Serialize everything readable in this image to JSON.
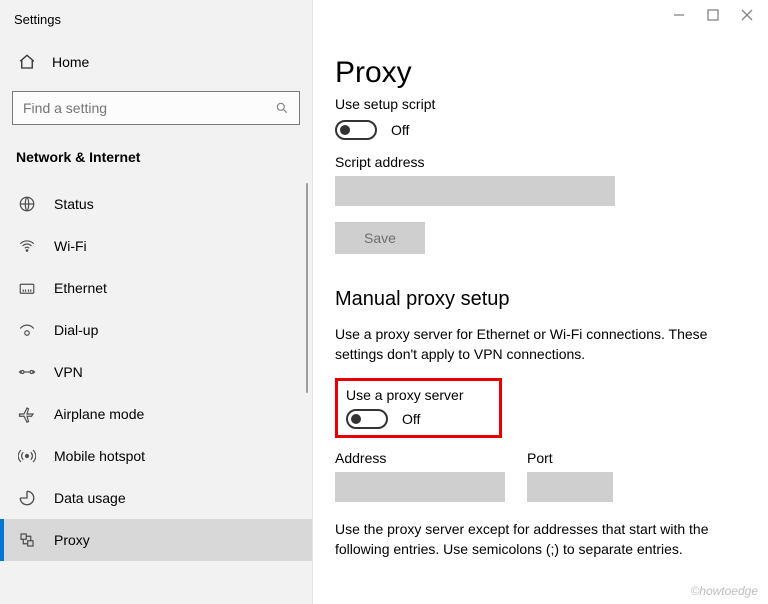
{
  "window": {
    "title": "Settings"
  },
  "sidebar": {
    "home_label": "Home",
    "search_placeholder": "Find a setting",
    "section_label": "Network & Internet",
    "items": [
      {
        "label": "Status"
      },
      {
        "label": "Wi-Fi"
      },
      {
        "label": "Ethernet"
      },
      {
        "label": "Dial-up"
      },
      {
        "label": "VPN"
      },
      {
        "label": "Airplane mode"
      },
      {
        "label": "Mobile hotspot"
      },
      {
        "label": "Data usage"
      },
      {
        "label": "Proxy"
      }
    ],
    "selected_index": 8
  },
  "main": {
    "title": "Proxy",
    "use_script_label": "Use setup script",
    "use_script_state": "Off",
    "script_address_label": "Script address",
    "script_address_value": "",
    "save_label": "Save",
    "manual_heading": "Manual proxy setup",
    "manual_desc": "Use a proxy server for Ethernet or Wi-Fi connections. These settings don't apply to VPN connections.",
    "use_proxy_label": "Use a proxy server",
    "use_proxy_state": "Off",
    "address_label": "Address",
    "address_value": "",
    "port_label": "Port",
    "port_value": "",
    "except_desc": "Use the proxy server except for addresses that start with the following entries. Use semicolons (;) to separate entries."
  },
  "watermark": "©howtoedge"
}
